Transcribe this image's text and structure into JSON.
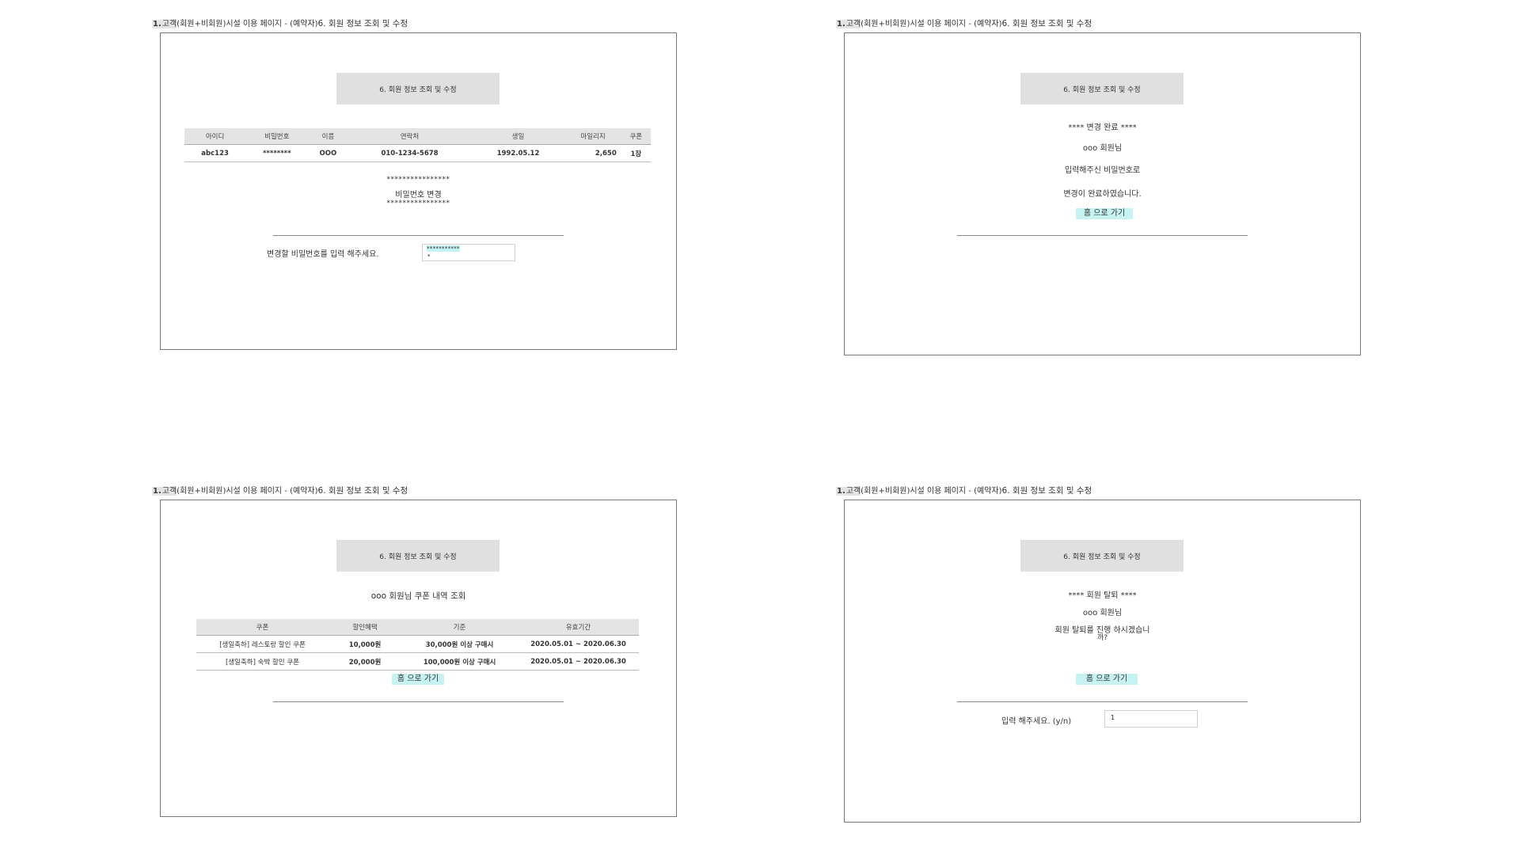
{
  "panels": {
    "p1": {
      "header": {
        "num": "1.",
        "prefix_hl": "고객",
        "prefix_rest": "(회원+비회원)시설 이용 페이지 - (예약자)",
        "title": "6. 회원 정보 조회 및 수정"
      },
      "box_title": "6. 회원 정보 조회 및 수정",
      "table": {
        "headers": [
          "아이디",
          "비밀번호",
          "이름",
          "연락처",
          "생일",
          "마일리지",
          "쿠폰"
        ],
        "row": [
          "abc123",
          "********",
          "OOO",
          "010-1234-5678",
          "1992.05.12",
          "2,650",
          "1장"
        ]
      },
      "stars": "****************",
      "change_label": "비밀번호 변경",
      "prompt": "변경할 비밀번호를 입력 해주세요.",
      "input_value": "***********",
      "input_value2": "*"
    },
    "p2": {
      "header": {
        "num": "1.",
        "prefix_hl": "고객",
        "prefix_rest": "(회원+비회원)시설 이용 페이지 - (예약자)",
        "title": "6. 회원 정보 조회 및 수정"
      },
      "box_title": "6. 회원 정보 조회 및 수정",
      "line1": "**** 변경 완료 ****",
      "line2": "ooo 회원님",
      "line3": "입력해주신 비밀번호로",
      "line4": "변경이 완료하였습니다.",
      "home_button": "홈 으로 가기"
    },
    "p3": {
      "header": {
        "num": "1.",
        "prefix_hl": "고객",
        "prefix_rest": "(회원+비회원)시설 이용 페이지 - (예약자)",
        "title": "6. 회원 정보 조회 및 수정"
      },
      "box_title": "6. 회원 정보 조회 및 수정",
      "subtitle": "ooo 회원님 쿠폰 내역 조회",
      "table": {
        "headers": [
          "쿠폰",
          "할인혜택",
          "기준",
          "유효기간"
        ],
        "rows": [
          [
            "[생일축하] 레스토랑 할인 쿠폰",
            "10,000원",
            "30,000원 이상 구매시",
            "2020.05.01 ~ 2020.06.30"
          ],
          [
            "[생일축하] 숙박 할인 쿠폰",
            "20,000원",
            "100,000원 이상 구매시",
            "2020.05.01 ~ 2020.06.30"
          ]
        ]
      },
      "home_button": "홈 으로 가기"
    },
    "p4": {
      "header": {
        "num": "1.",
        "prefix_hl": "고객",
        "prefix_rest": "(회원+비회원)시설 이용 페이지 - (예약자)",
        "title": "6. 회원 정보 조회 및 수정"
      },
      "box_title": "6. 회원 정보 조회 및 수정",
      "line1": "**** 회원 탈퇴 ****",
      "line2": "ooo 회원님",
      "line3": "회원 탈퇴를 진행 하시겠습니",
      "line4": "까?",
      "home_button": "홈 으로 가기",
      "prompt": "입력 해주세요. (y/n)",
      "input_value": "1"
    }
  }
}
